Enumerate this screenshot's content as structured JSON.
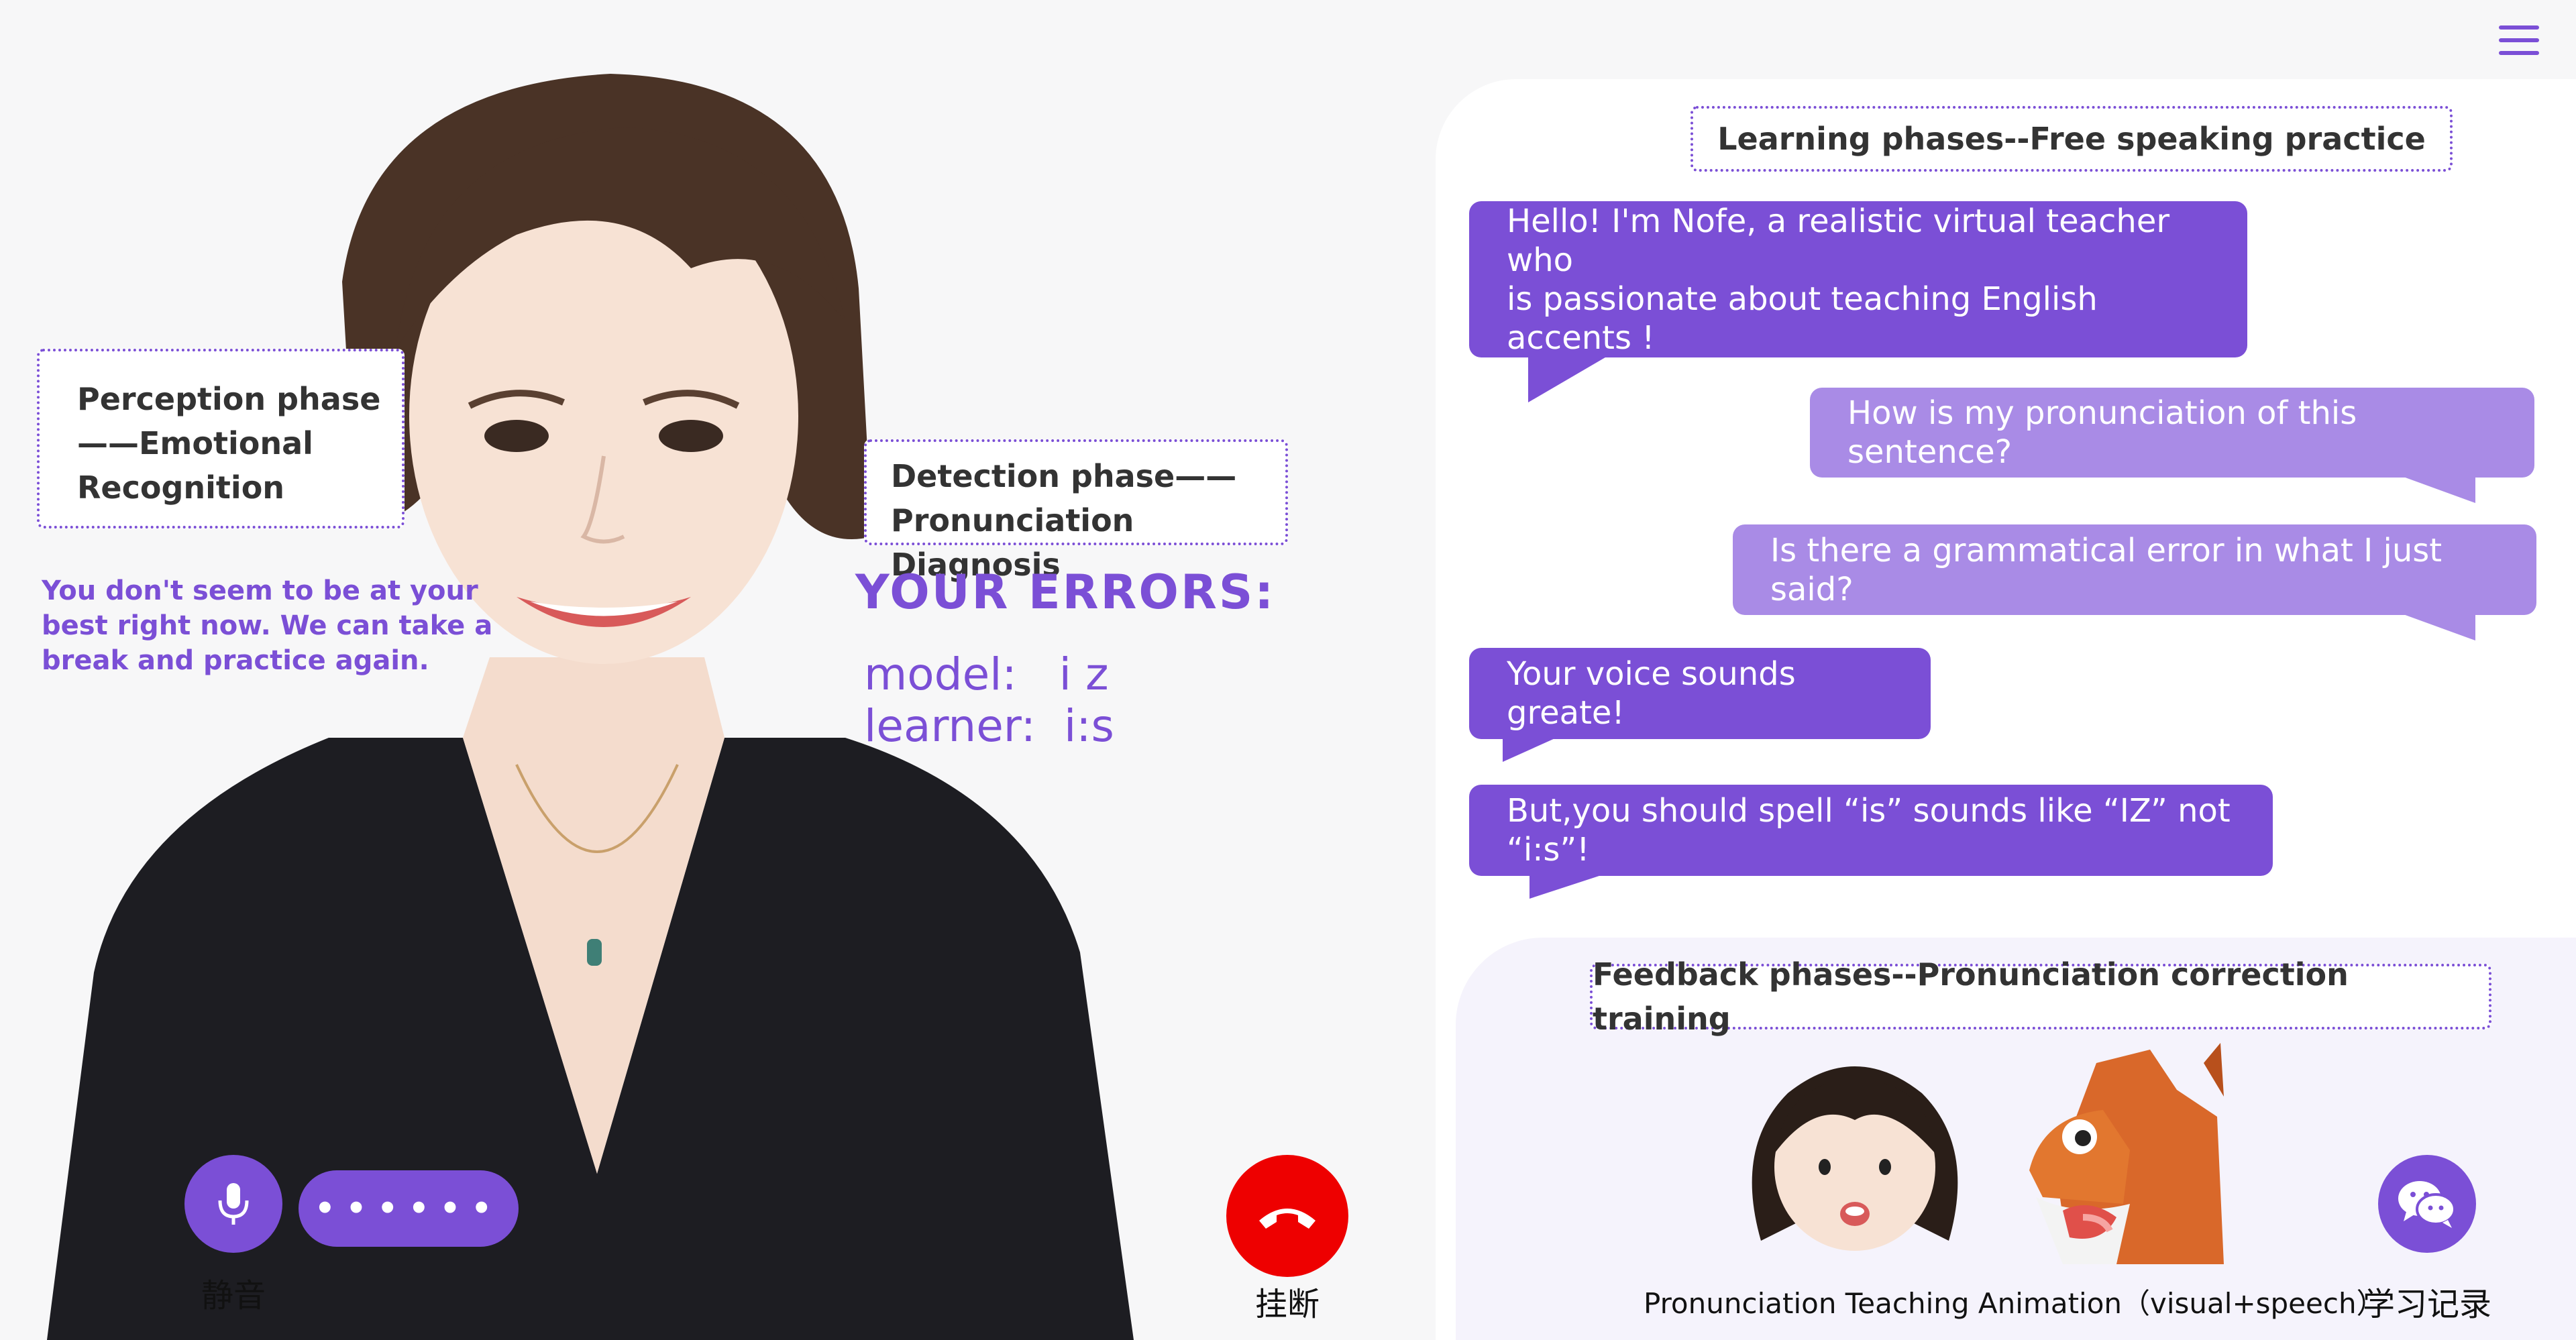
{
  "header": {
    "menu_icon": "hamburger-menu-icon"
  },
  "left": {
    "perception": {
      "line1": "Perception phase",
      "line2": "——Emotional",
      "line3": "Recognition"
    },
    "emotion_message": {
      "line1": "You don't seem to be at your",
      "line2": "best right now. We can take a",
      "line3": "break and practice again."
    },
    "detection": {
      "line1": "Detection phase——",
      "line2": "Pronunciation Diagnosis"
    },
    "errors": {
      "title": "YOUR ERRORS:",
      "model": "model:   i z",
      "learner": "learner:  i:s"
    },
    "controls": {
      "mute_icon": "microphone-icon",
      "mute_label": "静音",
      "dots": "••••••",
      "hangup_icon": "phone-hangup-icon",
      "hangup_label": "挂断"
    }
  },
  "chat": {
    "title": "Learning phases--Free speaking practice",
    "messages": [
      {
        "role": "teacher",
        "line1": "Hello!  I'm Nofe, a realistic virtual teacher who",
        "line2": "is passionate about teaching English accents !"
      },
      {
        "role": "learner",
        "text": "How is my pronunciation of this sentence?"
      },
      {
        "role": "learner",
        "text": "Is there a grammatical error in what I just said?"
      },
      {
        "role": "teacher",
        "text": "Your voice sounds greate!"
      },
      {
        "role": "teacher",
        "text": "But,you should spell “is” sounds like “IZ” not “i:s”!"
      }
    ]
  },
  "feedback": {
    "title": "Feedback phases--Pronunciation correction training",
    "animation_caption": "Pronunciation Teaching Animation（visual+speech）",
    "record_label": "学习记录",
    "record_icon": "wechat-icon"
  },
  "colors": {
    "accent": "#7b4fd6",
    "learner_bubble": "#a98be6",
    "hangup": "#ee0000"
  }
}
